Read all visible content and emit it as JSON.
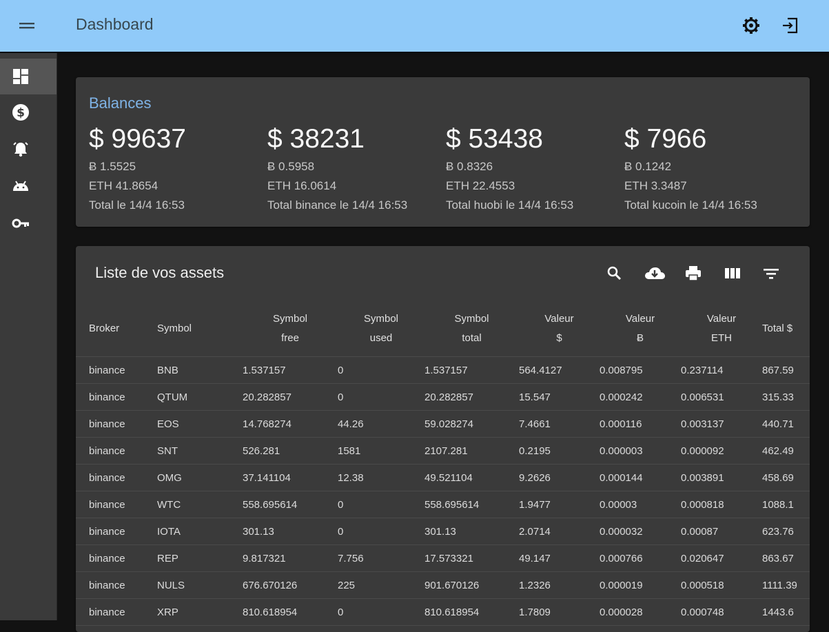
{
  "appbar": {
    "title": "Dashboard",
    "menu_icon": "menu-icon",
    "settings_icon": "settings-icon",
    "logout_icon": "logout-icon"
  },
  "sidebar": {
    "items": [
      {
        "icon": "dashboard-icon",
        "active": true
      },
      {
        "icon": "dollar-circle-icon",
        "active": false
      },
      {
        "icon": "alarm-bell-icon",
        "active": false
      },
      {
        "icon": "android-icon",
        "active": false
      },
      {
        "icon": "key-icon",
        "active": false
      }
    ]
  },
  "balances": {
    "title": "Balances",
    "cards": [
      {
        "amount": "$ 99637",
        "btc": "Ƀ 1.5525",
        "eth": "ETH 41.8654",
        "label": "Total le 14/4 16:53"
      },
      {
        "amount": "$ 38231",
        "btc": "Ƀ 0.5958",
        "eth": "ETH 16.0614",
        "label": "Total binance le 14/4 16:53"
      },
      {
        "amount": "$ 53438",
        "btc": "Ƀ 0.8326",
        "eth": "ETH 22.4553",
        "label": "Total huobi le 14/4 16:53"
      },
      {
        "amount": "$ 7966",
        "btc": "Ƀ 0.1242",
        "eth": "ETH 3.3487",
        "label": "Total kucoin le 14/4 16:53"
      }
    ]
  },
  "assets": {
    "title": "Liste de vos assets",
    "toolbar": [
      "search-icon",
      "cloud-download-icon",
      "print-icon",
      "view-columns-icon",
      "filter-icon"
    ],
    "columns": [
      {
        "l1": "Broker",
        "l2": ""
      },
      {
        "l1": "Symbol",
        "l2": ""
      },
      {
        "l1": "Symbol",
        "l2": "free"
      },
      {
        "l1": "Symbol",
        "l2": "used"
      },
      {
        "l1": "Symbol",
        "l2": "total"
      },
      {
        "l1": "Valeur",
        "l2": "$"
      },
      {
        "l1": "Valeur",
        "l2": "Ƀ"
      },
      {
        "l1": "Valeur",
        "l2": "ETH"
      },
      {
        "l1": "Total $",
        "l2": ""
      }
    ],
    "rows": [
      [
        "binance",
        "BNB",
        "1.537157",
        "0",
        "1.537157",
        "564.4127",
        "0.008795",
        "0.237114",
        "867.59"
      ],
      [
        "binance",
        "QTUM",
        "20.282857",
        "0",
        "20.282857",
        "15.547",
        "0.000242",
        "0.006531",
        "315.33"
      ],
      [
        "binance",
        "EOS",
        "14.768274",
        "44.26",
        "59.028274",
        "7.4661",
        "0.000116",
        "0.003137",
        "440.71"
      ],
      [
        "binance",
        "SNT",
        "526.281",
        "1581",
        "2107.281",
        "0.2195",
        "0.000003",
        "0.000092",
        "462.49"
      ],
      [
        "binance",
        "OMG",
        "37.141104",
        "12.38",
        "49.521104",
        "9.2626",
        "0.000144",
        "0.003891",
        "458.69"
      ],
      [
        "binance",
        "WTC",
        "558.695614",
        "0",
        "558.695614",
        "1.9477",
        "0.00003",
        "0.000818",
        "1088.1"
      ],
      [
        "binance",
        "IOTA",
        "301.13",
        "0",
        "301.13",
        "2.0714",
        "0.000032",
        "0.00087",
        "623.76"
      ],
      [
        "binance",
        "REP",
        "9.817321",
        "7.756",
        "17.573321",
        "49.147",
        "0.000766",
        "0.020647",
        "863.67"
      ],
      [
        "binance",
        "NULS",
        "676.670126",
        "225",
        "901.670126",
        "1.2326",
        "0.000019",
        "0.000518",
        "1111.39"
      ],
      [
        "binance",
        "XRP",
        "810.618954",
        "0",
        "810.618954",
        "1.7809",
        "0.000028",
        "0.000748",
        "1443.6"
      ]
    ]
  }
}
